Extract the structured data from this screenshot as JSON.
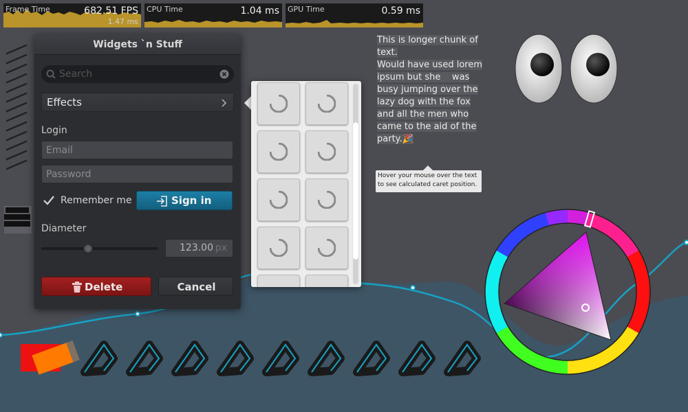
{
  "perf": {
    "frame": {
      "name": "Frame Time",
      "value": "682.51 FPS",
      "sub": "1.47 ms"
    },
    "cpu": {
      "name": "CPU Time",
      "value": "1.04 ms"
    },
    "gpu": {
      "name": "GPU Time",
      "value": "0.59 ms"
    }
  },
  "window": {
    "title": "Widgets `n Stuff",
    "search_placeholder": "Search",
    "effects_label": "Effects",
    "login_label": "Login",
    "email_placeholder": "Email",
    "password_placeholder": "Password",
    "remember_label": "Remember me",
    "remember_checked": true,
    "signin_label": "Sign in",
    "diameter_label": "Diameter",
    "diameter_value": "123.00",
    "diameter_unit": "px",
    "diameter_slider_fraction": 0.4,
    "delete_label": "Delete",
    "cancel_label": "Cancel"
  },
  "paragraph": {
    "lines": [
      "This is longer chunk of",
      "text.",
      "",
      "Would have used lorem",
      "ipsum but she    was",
      "busy jumping over the",
      "lazy dog with the fox",
      "and all the men who",
      "came to the aid of the",
      "party.🎉"
    ],
    "tooltip": "Hover your mouse over the text to see calculated caret position."
  },
  "colors": {
    "accent_blue": "#1c7fa6",
    "delete_red": "#a32020",
    "graph_fill": "#b8942a",
    "line_cyan": "#17a2c4"
  },
  "icons": {
    "search": "search-icon",
    "clear": "clear-icon",
    "effects_chevron": "chevron-right-icon",
    "checkbox": "checkmark-icon",
    "signin": "login-icon",
    "delete": "trash-icon",
    "thumbnail": "loading-spinner-icon"
  }
}
